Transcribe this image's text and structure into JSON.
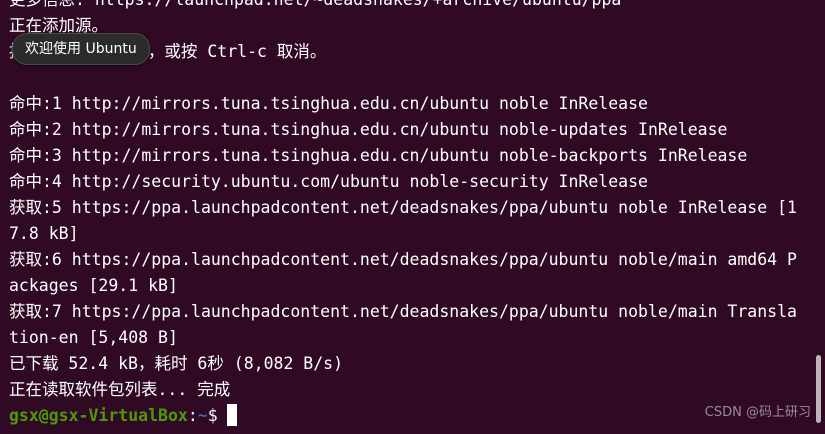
{
  "terminal": {
    "lines": [
      "更多信息: https://launchpad.net/~deadsnakes/+archive/ubuntu/ppa",
      "正在添加源。",
      "按 [ENTER] 继续，或按 Ctrl-c 取消。",
      "",
      "命中:1 http://mirrors.tuna.tsinghua.edu.cn/ubuntu noble InRelease",
      "命中:2 http://mirrors.tuna.tsinghua.edu.cn/ubuntu noble-updates InRelease",
      "命中:3 http://mirrors.tuna.tsinghua.edu.cn/ubuntu noble-backports InRelease",
      "命中:4 http://security.ubuntu.com/ubuntu noble-security InRelease",
      "获取:5 https://ppa.launchpadcontent.net/deadsnakes/ppa/ubuntu noble InRelease [1",
      "7.8 kB]",
      "获取:6 https://ppa.launchpadcontent.net/deadsnakes/ppa/ubuntu noble/main amd64 P",
      "ackages [29.1 kB]",
      "获取:7 https://ppa.launchpadcontent.net/deadsnakes/ppa/ubuntu noble/main Transla",
      "tion-en [5,408 B]",
      "已下载 52.4 kB，耗时 6秒 (8,082 B/s)",
      "正在读取软件包列表... 完成"
    ],
    "prompt": {
      "user_host": "gsx@gsx-VirtualBox",
      "separator": ":",
      "path": "~",
      "symbol": "$"
    }
  },
  "tooltip": {
    "text": "欢迎使用 Ubuntu"
  },
  "watermark": {
    "text": "CSDN @码上研习"
  },
  "colors": {
    "background": "#300a24",
    "text": "#ffffff",
    "prompt_user": "#4e9a06",
    "prompt_path": "#3465a4"
  }
}
